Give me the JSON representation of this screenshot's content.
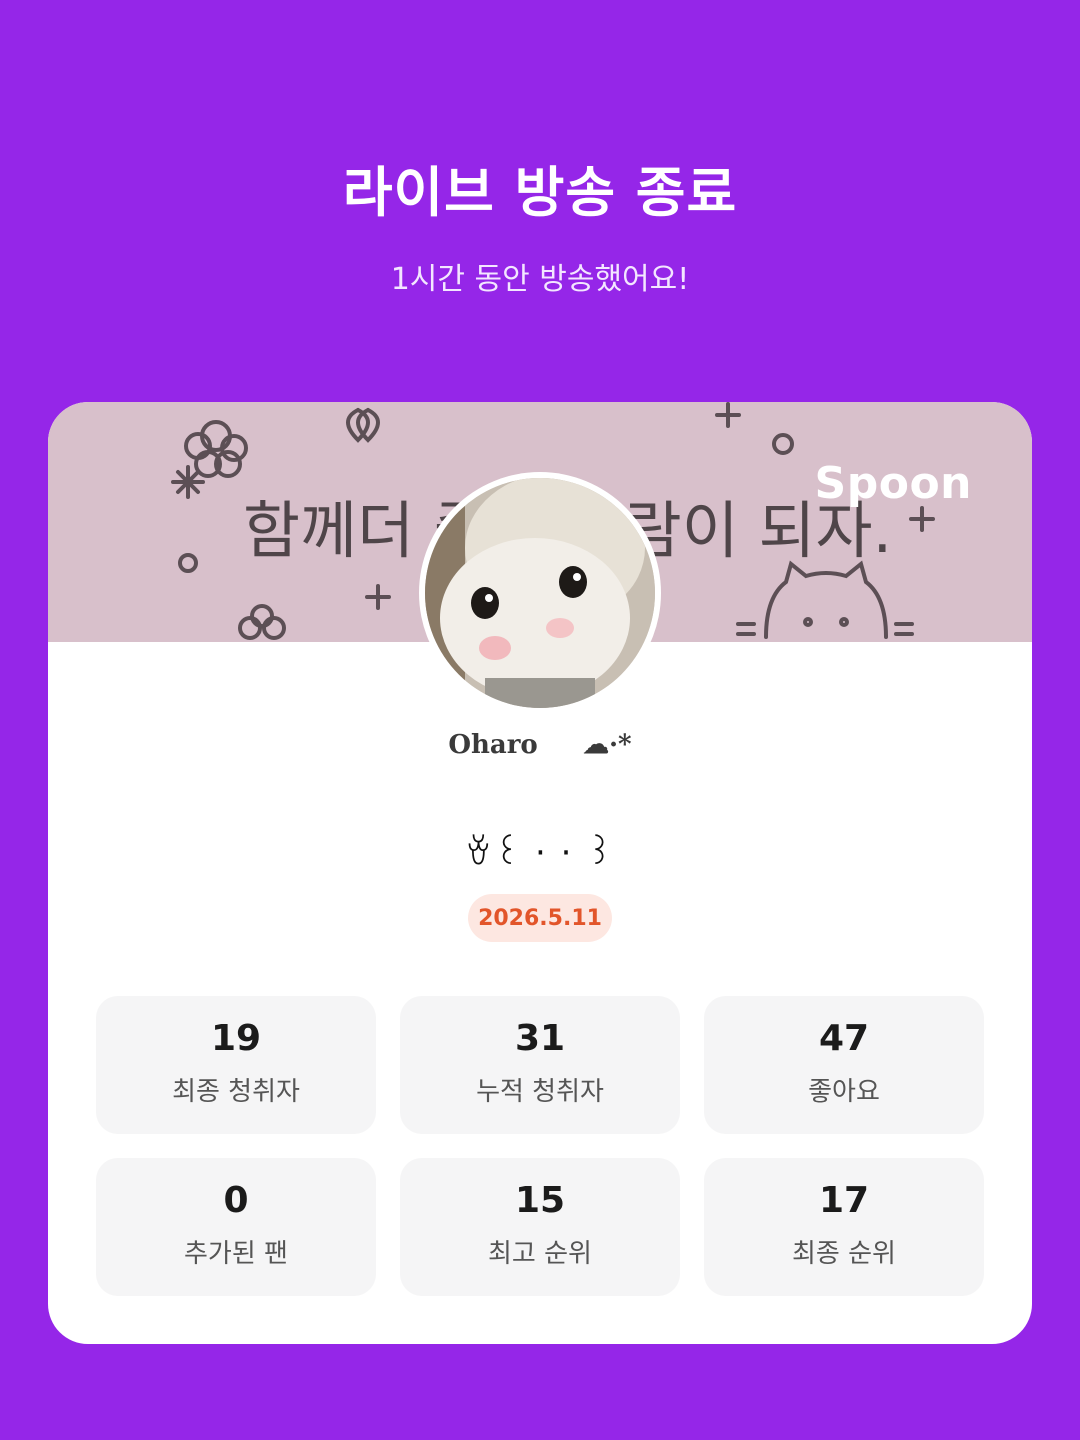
{
  "header": {
    "title": "라이브 방송 종료",
    "subtitle": "1시간 동안 방송했어요!"
  },
  "banner": {
    "text": "함께더 좋은 사람이 되자.",
    "brand": "Spoon"
  },
  "profile": {
    "nickname": "Oharo     ☁·*",
    "live_title": "ꈊ꒰ ·  · ꒱",
    "date": "2026.5.11"
  },
  "stats": [
    {
      "value": "19",
      "label": "최종 청취자"
    },
    {
      "value": "31",
      "label": "누적 청취자"
    },
    {
      "value": "47",
      "label": "좋아요"
    },
    {
      "value": "0",
      "label": "추가된 팬"
    },
    {
      "value": "15",
      "label": "최고 순위"
    },
    {
      "value": "17",
      "label": "최종 순위"
    }
  ],
  "colors": {
    "background": "#9526e8",
    "banner": "#d8c0cb",
    "badge_bg": "#fde7e1",
    "badge_text": "#e2552a"
  }
}
